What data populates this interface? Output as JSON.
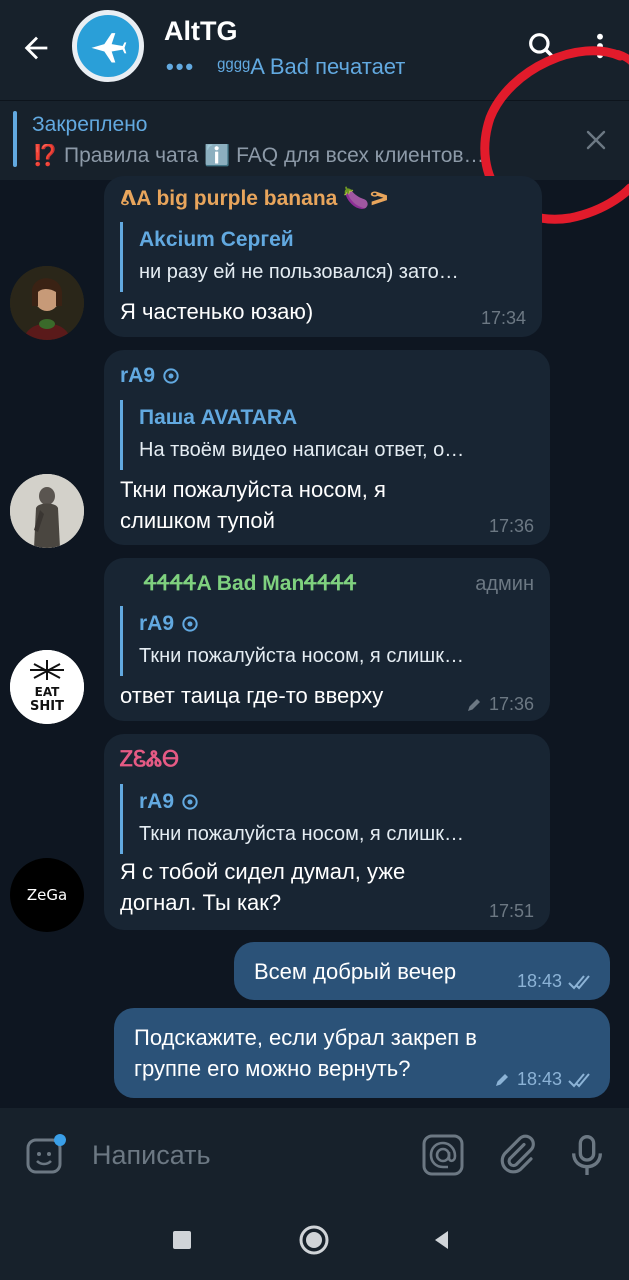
{
  "header": {
    "title": "AltTG",
    "typing_dots": "•••",
    "typing_text": "ᵍᵍᵍᵍA Bad печатает"
  },
  "pinned": {
    "title": "Закреплено",
    "text": "⁉️ Правила чата ℹ️ FAQ для всех клиентов…"
  },
  "messages": [
    {
      "sender": "ᕕA big purple banana 🍆ᕗ",
      "reply_name": "Akcium Сергей",
      "reply_text": "ни разу ей не пользовался) зато…",
      "text": "Я частенько юзаю)",
      "time": "17:34"
    },
    {
      "sender": "rA9",
      "reply_name": "Паша AVATARA",
      "reply_text": "На твоём видео написан ответ, о…",
      "text_line1": "Ткни пожалуйста носом, я",
      "text_line2": "слишком тупой",
      "time": "17:36"
    },
    {
      "sender": "ᏎᏎᏎᏎA Bad ManᏎᏎᏎᏎ",
      "role": "админ",
      "reply_name": "rA9",
      "reply_text": "Ткни пожалуйста носом, я слишк…",
      "text": "ответ таица где-то вверху",
      "time": "17:36",
      "avatar_label": "EAT SHIT"
    },
    {
      "sender": "ᏃᏋᏜᎾ",
      "reply_name": "rA9",
      "reply_text": "Ткни пожалуйста носом, я слишк…",
      "text_line1": "Я с тобой сидел думал, уже",
      "text_line2": "догнал. Ты как?",
      "time": "17:51",
      "avatar_label": "ZeGa"
    }
  ],
  "outgoing": [
    {
      "text": "Всем добрый вечер",
      "time": "18:43"
    },
    {
      "text_line1": "Подскажите, если убрал закреп в",
      "text_line2": "группе его можно вернуть?",
      "time": "18:43"
    }
  ],
  "input": {
    "placeholder": "Написать"
  },
  "colors": {
    "background": "#0e1621",
    "header": "#17212b",
    "bubble_in": "#182533",
    "bubble_out": "#2b5278",
    "accent": "#62a9e0",
    "sender_orange": "#e8a55c",
    "sender_blue": "#62a9e0",
    "sender_green": "#7fd17f",
    "sender_pink": "#e55a84",
    "annotation_red": "#e21b2b"
  },
  "icons": [
    "back-arrow-icon",
    "group-avatar-jet-icon",
    "search-icon",
    "more-vert-icon",
    "close-icon",
    "settings-gear-icon",
    "edit-pencil-icon",
    "double-check-icon",
    "sticker-icon",
    "mention-icon",
    "attach-icon",
    "mic-icon",
    "nav-square-icon",
    "nav-circle-icon",
    "nav-back-icon"
  ]
}
